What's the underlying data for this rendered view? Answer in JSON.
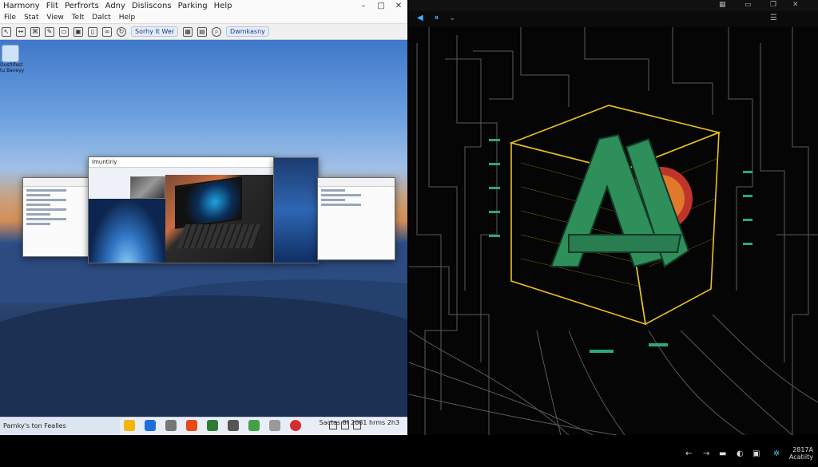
{
  "left_window": {
    "title_items": [
      "Harmony",
      "Flit",
      "Perfrorts",
      "Adny",
      "Disliscons",
      "Parking",
      "Help"
    ],
    "menu_items": [
      "File",
      "Stat",
      "View",
      "Telt",
      "Dalct",
      "Help"
    ],
    "toolbar_labels": {
      "search_button": "Sorhy lt Wer",
      "user_button": "Dwmkasny"
    },
    "desktop_icon_label": "Dustlifest tu Baveyy"
  },
  "task_view": {
    "main_window_title": "Imuntiriy"
  },
  "taskbar_left": {
    "search_text": "Parnky's ton Fealles",
    "clock_text": "Sactas 8f 2081 hrms 2h3"
  },
  "right_pane": {
    "clock_line1": "2817A",
    "clock_line2": "Acatiity"
  },
  "colors": {
    "accent_blue": "#3fb3ff",
    "circuit_line": "#5a5a5a",
    "cube_outline": "#e8c020",
    "logo_green": "#2f8f5a",
    "logo_red": "#c0352b"
  }
}
